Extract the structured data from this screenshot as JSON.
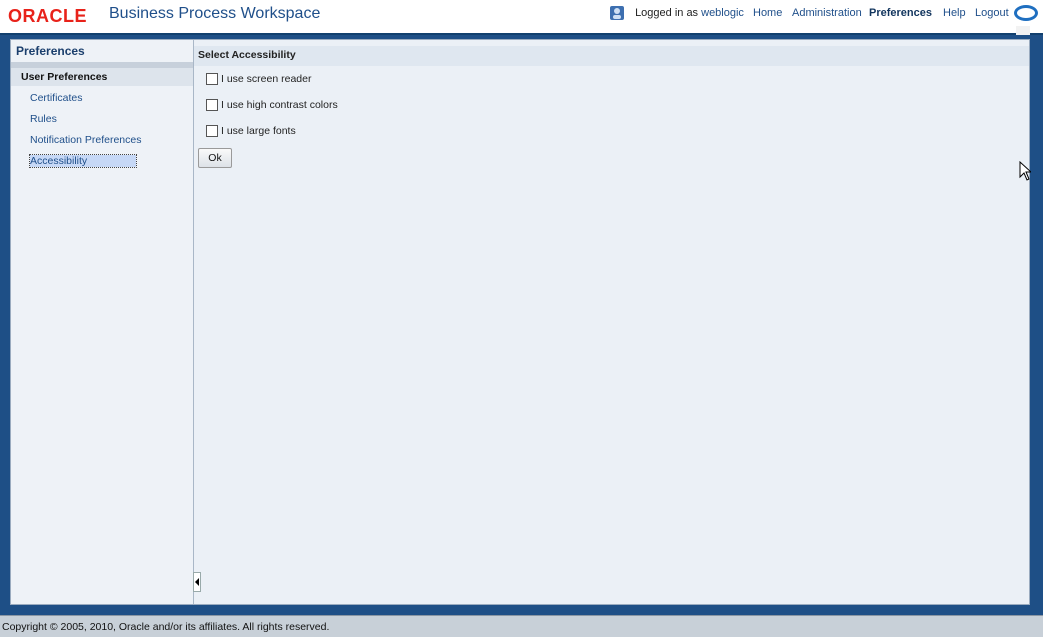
{
  "header": {
    "logo": "ORACLE",
    "app_title": "Business Process Workspace",
    "logged_in_prefix": "Logged in as",
    "user": "weblogic",
    "nav": [
      {
        "label": "Home"
      },
      {
        "label": "Administration"
      },
      {
        "label": "Preferences",
        "active": true
      },
      {
        "label": "Help"
      },
      {
        "label": "Logout"
      }
    ]
  },
  "sidebar": {
    "title": "Preferences",
    "section": "User Preferences",
    "items": [
      {
        "label": "Certificates"
      },
      {
        "label": "Rules"
      },
      {
        "label": "Notification Preferences"
      },
      {
        "label": "Accessibility",
        "selected": true
      }
    ]
  },
  "content": {
    "heading": "Select Accessibility",
    "options": [
      {
        "label": "I use screen reader",
        "checked": false
      },
      {
        "label": "I use high contrast colors",
        "checked": false
      },
      {
        "label": "I use large fonts",
        "checked": false
      }
    ],
    "ok_label": "Ok"
  },
  "footer": {
    "copyright": "Copyright © 2005, 2010, Oracle and/or its affiliates. All rights reserved."
  },
  "colors": {
    "brand_red": "#e8221a",
    "link_blue": "#1f4f8a",
    "desktop_blue": "#1e4f86"
  }
}
